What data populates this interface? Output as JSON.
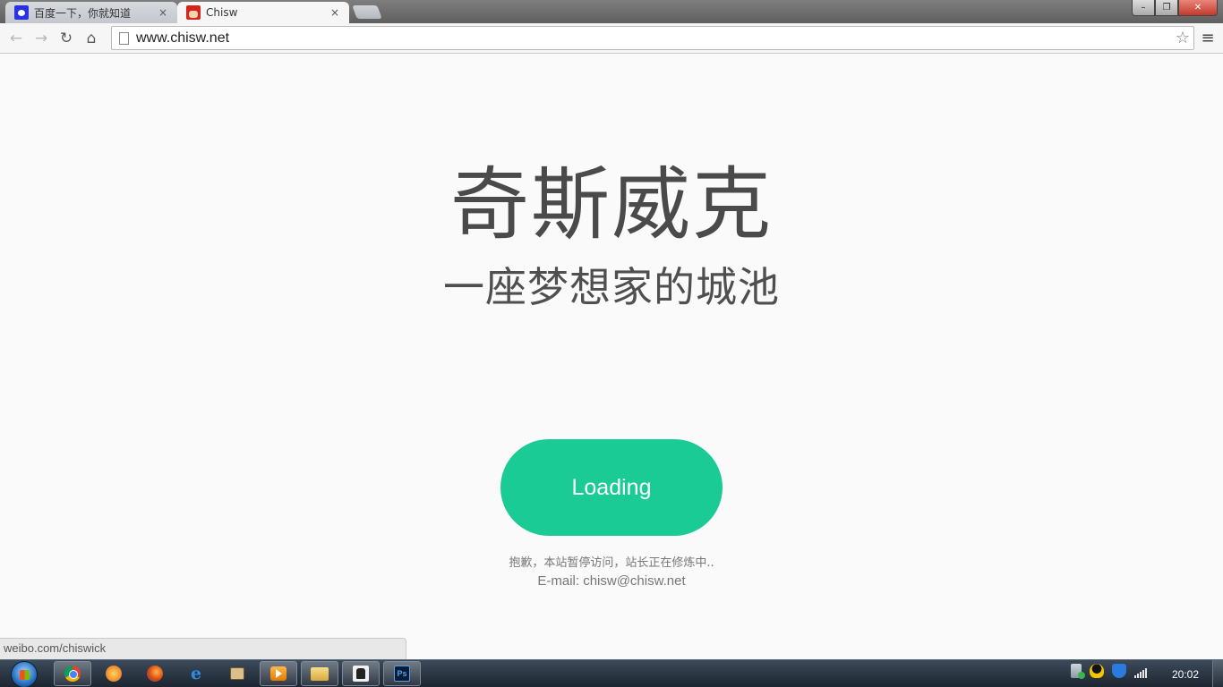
{
  "browser": {
    "tabs": [
      {
        "title": "百度一下，你就知道",
        "favicon": "baidu-paw-icon",
        "active": false
      },
      {
        "title": "Chisw",
        "favicon": "chisw-avatar-icon",
        "active": true
      }
    ],
    "tab_close_glyph": "×",
    "window_controls": {
      "minimize": "–",
      "maximize": "❐",
      "close": "✕"
    },
    "toolbar": {
      "back_glyph": "←",
      "forward_glyph": "→",
      "reload_glyph": "↻",
      "home_glyph": "⌂",
      "url": "www.chisw.net",
      "star_glyph": "☆",
      "menu_glyph": "≡"
    },
    "status_url": "weibo.com/chiswick"
  },
  "page": {
    "title": "奇斯威克",
    "subtitle": "一座梦想家的城池",
    "button_label": "Loading",
    "notice": "抱歉，本站暂停访问，站长正在修炼中..",
    "email": "E-mail: chisw@chisw.net",
    "accent_color": "#1bcb96"
  },
  "taskbar": {
    "pinned": [
      {
        "name": "chrome-icon",
        "open": true
      },
      {
        "name": "orange-app-icon",
        "open": false
      },
      {
        "name": "firefox-icon",
        "open": false
      },
      {
        "name": "internet-explorer-icon",
        "open": false
      },
      {
        "name": "package-icon",
        "open": false
      },
      {
        "name": "media-player-icon",
        "open": true
      },
      {
        "name": "file-explorer-icon",
        "open": true
      },
      {
        "name": "game-icon",
        "open": true
      },
      {
        "name": "photoshop-icon",
        "open": true
      }
    ],
    "ie_glyph": "e",
    "ps_label": "Ps",
    "tray_icons": [
      "usb-safe-remove-icon",
      "qq-icon",
      "security-shield-icon",
      "network-signal-icon"
    ],
    "clock": "20:02"
  }
}
